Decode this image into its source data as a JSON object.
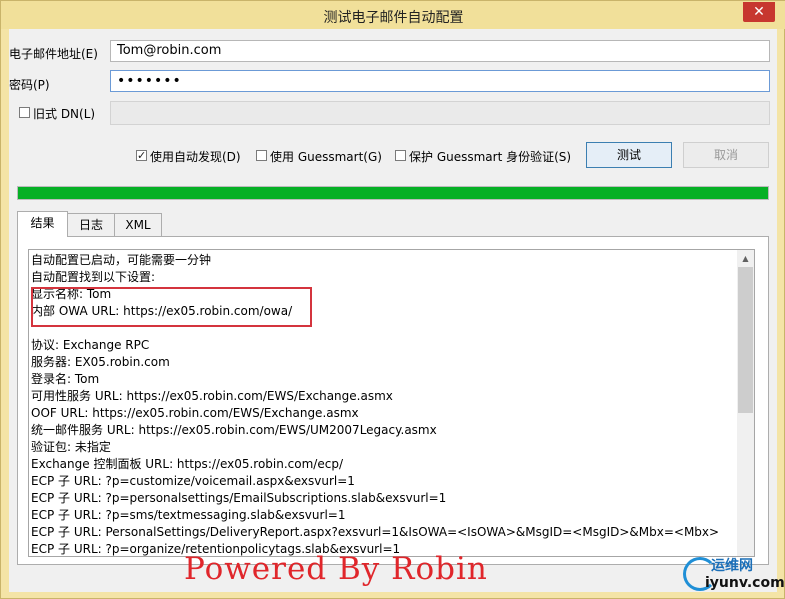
{
  "window": {
    "title": "测试电子邮件自动配置",
    "close_glyph": "✕"
  },
  "form": {
    "email_label": "电子邮件地址(E)",
    "email_value": "Tom@robin.com",
    "password_label": "密码(P)",
    "password_value": "•••••••",
    "legacy_dn_label": "旧式 DN(L)",
    "legacy_dn_value": ""
  },
  "options": {
    "autodiscover_label": "使用自动发现(D)",
    "autodiscover_checked": true,
    "guessmart_label": "使用 Guessmart(G)",
    "guessmart_checked": false,
    "secure_guessmart_label": "保护 Guessmart 身份验证(S)",
    "secure_guessmart_checked": false,
    "check_glyph": "✓"
  },
  "buttons": {
    "test_label": "测试",
    "cancel_label": "取消"
  },
  "progress": {
    "fraction": 1.0,
    "color": "#06b025"
  },
  "tabs": [
    {
      "label": "结果"
    },
    {
      "label": "日志"
    },
    {
      "label": "XML"
    }
  ],
  "results": {
    "lines": [
      "自动配置已启动，可能需要一分钟",
      "自动配置找到以下设置:",
      "显示名称: Tom",
      "内部 OWA URL: https://ex05.robin.com/owa/",
      "",
      "协议: Exchange RPC",
      "服务器: EX05.robin.com",
      "登录名: Tom",
      "可用性服务 URL: https://ex05.robin.com/EWS/Exchange.asmx",
      "OOF URL: https://ex05.robin.com/EWS/Exchange.asmx",
      "统一邮件服务 URL: https://ex05.robin.com/EWS/UM2007Legacy.asmx",
      "验证包: 未指定",
      "Exchange 控制面板 URL: https://ex05.robin.com/ecp/",
      "ECP 子 URL: ?p=customize/voicemail.aspx&exsvurl=1",
      "ECP 子 URL: ?p=personalsettings/EmailSubscriptions.slab&exsvurl=1",
      "ECP 子 URL: ?p=sms/textmessaging.slab&exsvurl=1",
      "ECP 子 URL: PersonalSettings/DeliveryReport.aspx?exsvurl=1&IsOWA=<IsOWA>&MsgID=<MsgID>&Mbx=<Mbx>",
      "ECP 子 URL: ?p=organize/retentionpolicytags.slab&exsvurl=1"
    ],
    "highlight_color": "#d4343d"
  },
  "watermark": {
    "text": "Powered By Robin",
    "color": "#e0262b"
  },
  "logo": {
    "line1": "运维网",
    "line2": "iyunv.com"
  }
}
